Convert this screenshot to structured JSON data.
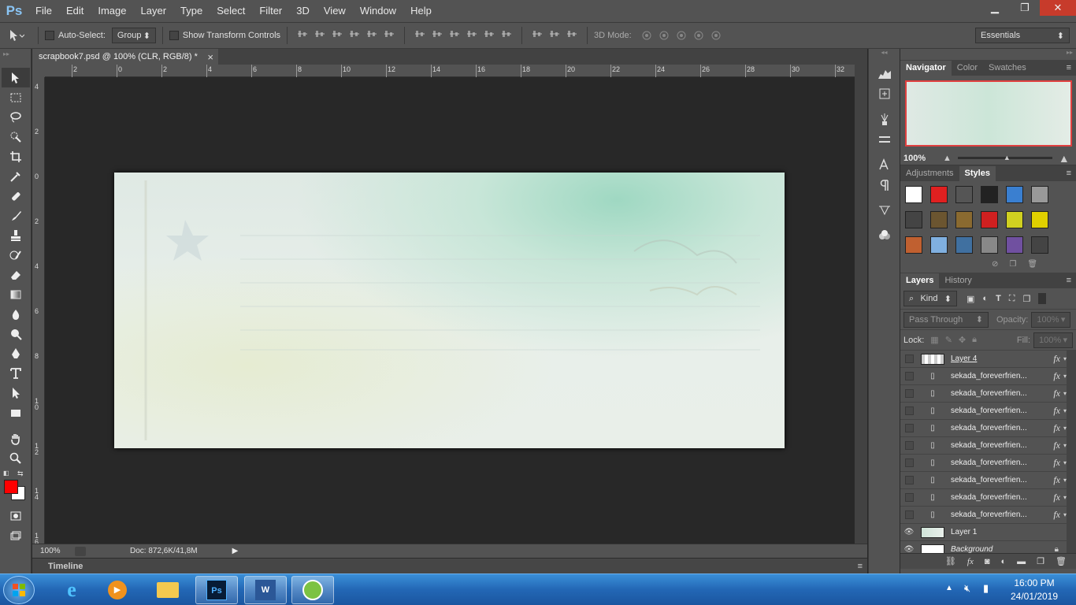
{
  "app": {
    "logo": "Ps"
  },
  "menu": [
    "File",
    "Edit",
    "Image",
    "Layer",
    "Type",
    "Select",
    "Filter",
    "3D",
    "View",
    "Window",
    "Help"
  ],
  "window_controls": {
    "minimize": "▁",
    "restore": "❐",
    "close": "✕"
  },
  "options": {
    "auto_select_label": "Auto-Select:",
    "auto_select_value": "Group",
    "show_transform_label": "Show Transform Controls",
    "mode_3d_label": "3D Mode:",
    "workspace": "Essentials"
  },
  "document": {
    "tab_title": "scrapbook7.psd @ 100% (CLR, RGB/8) *",
    "tab_close": "×",
    "zoom": "100%",
    "doc_info": "Doc: 872,6K/41,8M"
  },
  "ruler_h_labels": [
    "2",
    "0",
    "2",
    "4",
    "6",
    "8",
    "10",
    "12",
    "14",
    "16",
    "18",
    "20",
    "22",
    "24",
    "26",
    "28",
    "30",
    "32"
  ],
  "ruler_v_labels": [
    "4",
    "2",
    "0",
    "2",
    "4",
    "6",
    "8",
    "1\n0",
    "1\n2",
    "1\n4",
    "1\n6"
  ],
  "timeline_label": "Timeline",
  "panels": {
    "navigator_tabs": [
      "Navigator",
      "Color",
      "Swatches"
    ],
    "navigator_zoom": "100%",
    "style_tabs": [
      "Adjustments",
      "Styles"
    ],
    "layer_tabs": [
      "Layers",
      "History"
    ],
    "kind_label": "Kind",
    "blend_mode": "Pass Through",
    "opacity_label": "Opacity:",
    "opacity_value": "100%",
    "lock_label": "Lock:",
    "fill_label": "Fill:",
    "fill_value": "100%",
    "fx_label": "fx"
  },
  "layers": [
    {
      "name": "Layer 4",
      "type": "pixel",
      "eye": false
    },
    {
      "name": "sekada_foreverfrien...",
      "type": "smart",
      "eye": false
    },
    {
      "name": "sekada_foreverfrien...",
      "type": "smart",
      "eye": false
    },
    {
      "name": "sekada_foreverfrien...",
      "type": "smart",
      "eye": false
    },
    {
      "name": "sekada_foreverfrien...",
      "type": "smart",
      "eye": false
    },
    {
      "name": "sekada_foreverfrien...",
      "type": "smart",
      "eye": false
    },
    {
      "name": "sekada_foreverfrien...",
      "type": "smart",
      "eye": false
    },
    {
      "name": "sekada_foreverfrien...",
      "type": "smart",
      "eye": false
    },
    {
      "name": "sekada_foreverfrien...",
      "type": "smart",
      "eye": false
    },
    {
      "name": "sekada_foreverfrien...",
      "type": "smart",
      "eye": false
    },
    {
      "name": "Layer 1",
      "type": "pixel",
      "eye": true
    },
    {
      "name": "Background",
      "type": "background",
      "eye": true
    }
  ],
  "colors": {
    "foreground": "#ff0000",
    "background": "#ffffff",
    "accent": "#e04040"
  },
  "taskbar": {
    "time": "16:00 PM",
    "date": "24/01/2019"
  }
}
